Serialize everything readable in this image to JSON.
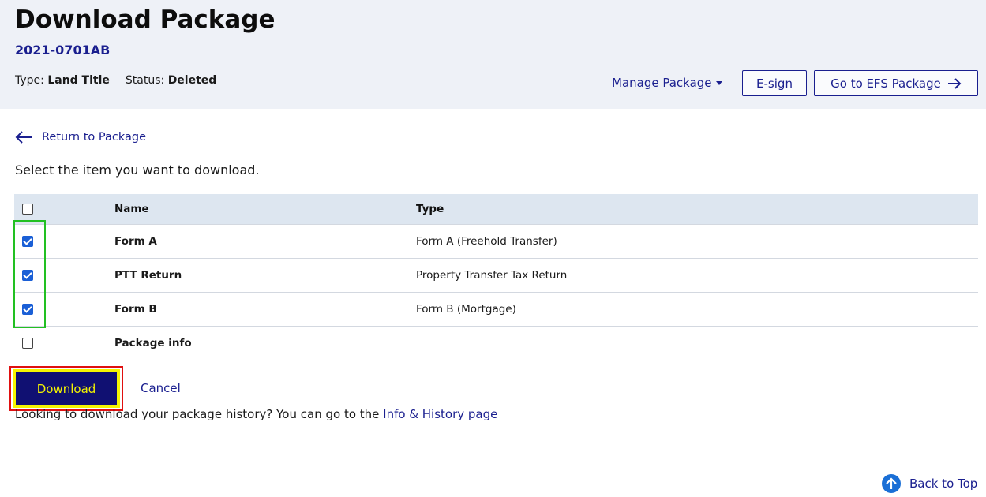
{
  "header": {
    "title": "Download Package",
    "package_id": "2021-0701AB",
    "type_label": "Type:",
    "type_value": "Land Title",
    "status_label": "Status:",
    "status_value": "Deleted",
    "manage_label": "Manage Package",
    "esign_label": "E-sign",
    "efs_label": "Go to EFS Package"
  },
  "back_link": "Return to Package",
  "instruction": "Select the item you want to download.",
  "table": {
    "headers": [
      "Name",
      "Type"
    ],
    "rows": [
      {
        "name": "Form A",
        "type": "Form A (Freehold Transfer)",
        "checked": true
      },
      {
        "name": "PTT Return",
        "type": "Property Transfer Tax Return",
        "checked": true
      },
      {
        "name": "Form B",
        "type": "Form B (Mortgage)",
        "checked": true
      },
      {
        "name": "Package info",
        "type": "",
        "checked": false
      }
    ]
  },
  "actions": {
    "download_label": "Download",
    "cancel_label": "Cancel"
  },
  "history": {
    "text": "Looking to download your package history? You can go to the ",
    "link": "Info & History page"
  },
  "back_to_top": "Back to Top",
  "colors": {
    "brand_navy": "#1a1f8f",
    "download_bg": "#101072",
    "download_text": "#f5f500",
    "header_bg": "#eef1f7",
    "table_header_bg": "#dde6f0",
    "checkbox_blue": "#1a5fd6",
    "highlight_green": "#22c022",
    "highlight_red": "#e01010"
  }
}
